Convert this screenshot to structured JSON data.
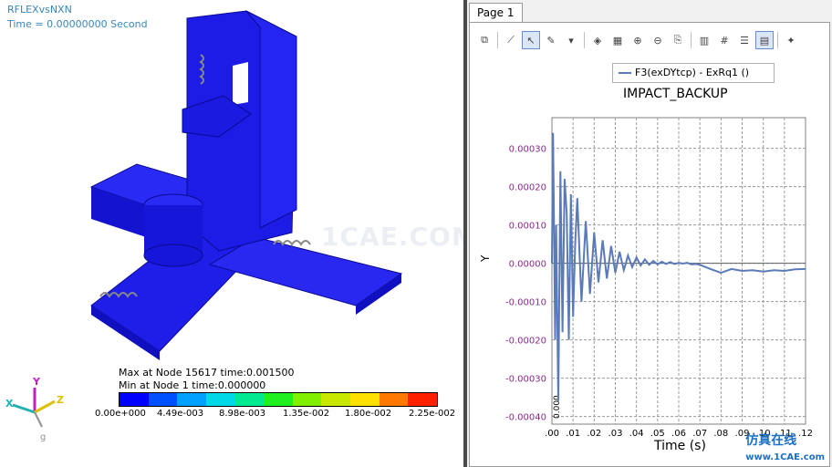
{
  "model_view": {
    "title": "RFLEXvsNXN",
    "time": "Time = 0.00000000 Second",
    "max_info": "Max at Node 15617 time:0.001500",
    "min_info": "Min at Node 1 time:0.000000",
    "legend_values": [
      "0.00e+000",
      "4.49e-003",
      "8.98e-003",
      "1.35e-002",
      "1.80e-002",
      "2.25e-002"
    ],
    "legend_colors": [
      "#0000ff",
      "#0050ff",
      "#00a0ff",
      "#00d8e8",
      "#00e890",
      "#20f020",
      "#80f000",
      "#c8e800",
      "#ffe000",
      "#ff7800",
      "#ff2000"
    ],
    "triad": {
      "x": "X",
      "y": "Y",
      "z": "Z",
      "g": "g"
    },
    "watermark": "1CAE.COM"
  },
  "plot_view": {
    "tab_label": "Page 1",
    "toolbar_icons": [
      "copy-icon",
      "line-chart-icon",
      "pointer-icon",
      "brush-icon",
      "3d-icon",
      "grid-icon",
      "pan-icon",
      "zoom-icon",
      "export-icon",
      "bar-chart-icon",
      "stats-icon",
      "table-icon",
      "legend-icon",
      "settings-icon"
    ],
    "legend_entry": "F3(exDYtcp) - ExRq1 ()",
    "watermark_main": "仿真在线",
    "watermark_sub": "www.1CAE.com"
  },
  "chart_data": {
    "type": "line",
    "title": "IMPACT_BACKUP",
    "xlabel": "Time (s)",
    "ylabel": "Y",
    "xlim": [
      0.0,
      0.12
    ],
    "ylim": [
      -0.00042,
      0.00038
    ],
    "x_ticks": [
      ".00",
      ".01",
      ".02",
      ".03",
      ".04",
      ".05",
      ".06",
      ".07",
      ".08",
      ".09",
      ".10",
      ".11",
      ".12"
    ],
    "y_ticks": [
      "0.00030",
      "0.00020",
      "0.00010",
      "0.00000",
      "-0.00010",
      "-0.00020",
      "-0.00030",
      "-0.00040"
    ],
    "y_tick_values": [
      0.0003,
      0.0002,
      0.0001,
      0.0,
      -0.0001,
      -0.0002,
      -0.0003,
      -0.0004
    ],
    "x_corner_label": "0.000",
    "grid": true,
    "series": [
      {
        "name": "F3(exDYtcp) - ExRq1 ()",
        "color": "#5a7ab8",
        "x": [
          0.0,
          0.0005,
          0.001,
          0.0015,
          0.002,
          0.003,
          0.004,
          0.005,
          0.006,
          0.007,
          0.008,
          0.009,
          0.01,
          0.011,
          0.012,
          0.014,
          0.016,
          0.018,
          0.02,
          0.022,
          0.024,
          0.026,
          0.028,
          0.03,
          0.032,
          0.034,
          0.036,
          0.038,
          0.04,
          0.042,
          0.044,
          0.046,
          0.048,
          0.05,
          0.052,
          0.054,
          0.056,
          0.058,
          0.06,
          0.062,
          0.064,
          0.066,
          0.068,
          0.07,
          0.075,
          0.08,
          0.085,
          0.09,
          0.095,
          0.1,
          0.105,
          0.11,
          0.115,
          0.12
        ],
        "y": [
          0.0,
          0.00034,
          0.0001,
          -0.0002,
          0.0001,
          -0.00036,
          0.00024,
          -0.00018,
          0.00022,
          0.00013,
          -0.0002,
          0.00018,
          -0.00014,
          5e-05,
          0.00017,
          -0.0001,
          0.00011,
          -8e-05,
          8e-05,
          -5e-05,
          6e-05,
          -4e-05,
          4.5e-05,
          -2.5e-05,
          3e-05,
          -1.8e-05,
          2e-05,
          -1e-05,
          1.5e-05,
          -6e-06,
          1e-05,
          -4e-06,
          6e-06,
          -3e-06,
          4e-06,
          -2e-06,
          3e-06,
          -2e-06,
          1e-06,
          -1e-06,
          1e-06,
          -3e-06,
          -2e-06,
          -4e-06,
          -1.5e-05,
          -2.5e-05,
          -1.5e-05,
          -2e-05,
          -1.8e-05,
          -2.2e-05,
          -1.8e-05,
          -2e-05,
          -1.6e-05,
          -1.5e-05
        ]
      }
    ]
  }
}
